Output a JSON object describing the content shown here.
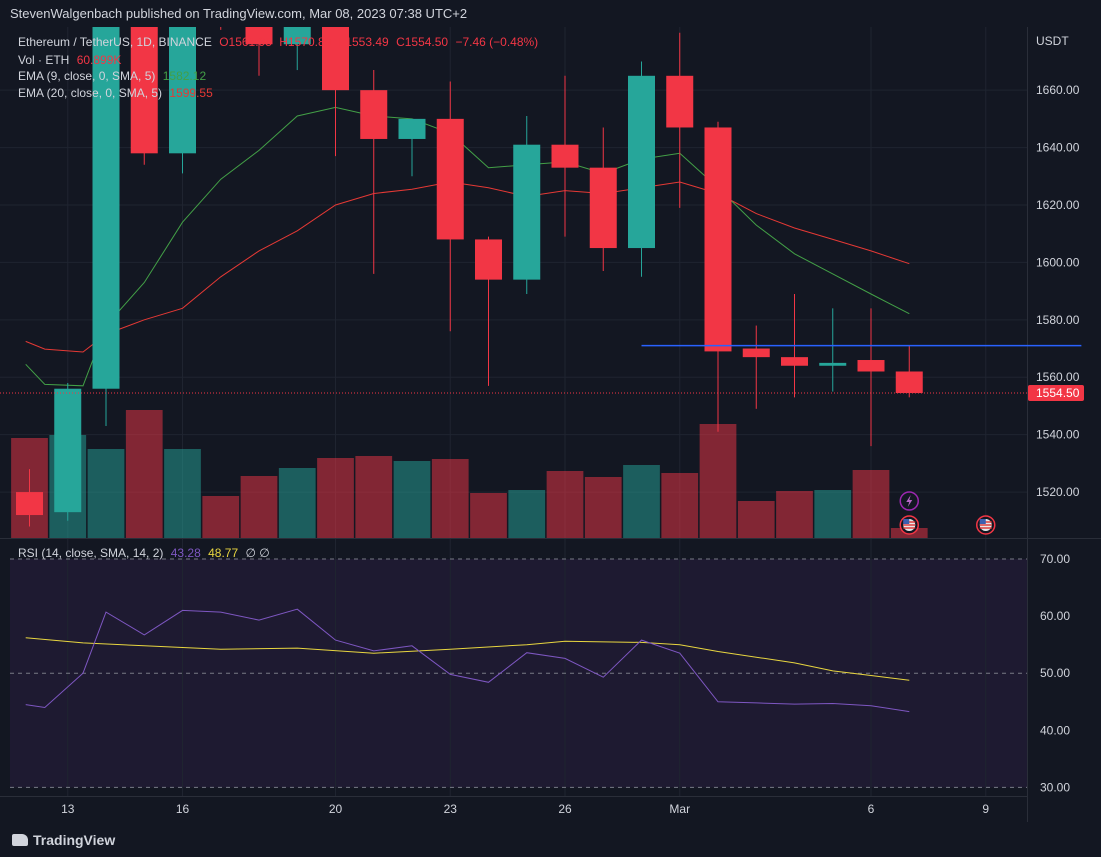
{
  "header": {
    "publish_text": "StevenWalgenbach published on TradingView.com, Mar 08, 2023 07:38 UTC+2"
  },
  "legend": {
    "symbol": "Ethereum / TetherUS, 1D, BINANCE",
    "open": "O1561.95",
    "high": "H1570.89",
    "low": "L1553.49",
    "close": "C1554.50",
    "change": "−7.46 (−0.48%)",
    "vol_label": "Vol · ETH",
    "vol_value": "60.899K",
    "ema9_label": "EMA (9, close, 0, SMA, 5)",
    "ema9_value": "1582.12",
    "ema20_label": "EMA (20, close, 0, SMA, 5)",
    "ema20_value": "1599.55",
    "rsi_label": "RSI (14, close, SMA, 14, 2)",
    "rsi_value": "43.28",
    "rsi_sma_value": "48.77",
    "rsi_extra": "∅ ∅"
  },
  "price_axis": {
    "unit": "USDT",
    "last_price": "1554.50"
  },
  "footer": {
    "brand": "TradingView"
  },
  "colors": {
    "up": "#26a69a",
    "down": "#f23645",
    "ema9": "#43a047",
    "ema20": "#e53935",
    "rsi": "#7e57c2",
    "rsi_sma": "#e8d640",
    "hline": "#2962ff"
  },
  "chart_data": [
    {
      "type": "candlestick",
      "title": "Ethereum / TetherUS, 1D, BINANCE",
      "x_ticks": [
        {
          "day": 1,
          "label": "13"
        },
        {
          "day": 4,
          "label": "16"
        },
        {
          "day": 8,
          "label": "20"
        },
        {
          "day": 11,
          "label": "23"
        },
        {
          "day": 14,
          "label": "26"
        },
        {
          "day": 17,
          "label": "Mar"
        },
        {
          "day": 22,
          "label": "6"
        },
        {
          "day": 25,
          "label": "9"
        }
      ],
      "y_ticks": [
        1520,
        1540,
        1560,
        1580,
        1600,
        1620,
        1640,
        1660
      ],
      "ylim": [
        1504,
        1682
      ],
      "candles": [
        {
          "day": 0,
          "open": 1520,
          "high": 1528,
          "low": 1508,
          "close": 1512
        },
        {
          "day": 1,
          "open": 1513,
          "high": 1558,
          "low": 1510,
          "close": 1556
        },
        {
          "day": 2,
          "open": 1556,
          "high": 1703,
          "low": 1543,
          "close": 1697
        },
        {
          "day": 3,
          "open": 1697,
          "high": 1701,
          "low": 1634,
          "close": 1638
        },
        {
          "day": 4,
          "open": 1638,
          "high": 1708,
          "low": 1631,
          "close": 1701
        },
        {
          "day": 5,
          "open": 1701,
          "high": 1712,
          "low": 1681,
          "close": 1695
        },
        {
          "day": 6,
          "open": 1695,
          "high": 1709,
          "low": 1665,
          "close": 1676
        },
        {
          "day": 7,
          "open": 1676,
          "high": 1705,
          "low": 1667,
          "close": 1701
        },
        {
          "day": 8,
          "open": 1701,
          "high": 1704,
          "low": 1637,
          "close": 1660
        },
        {
          "day": 9,
          "open": 1660,
          "high": 1667,
          "low": 1596,
          "close": 1643
        },
        {
          "day": 10,
          "open": 1643,
          "high": 1650,
          "low": 1630,
          "close": 1650
        },
        {
          "day": 11,
          "open": 1650,
          "high": 1663,
          "low": 1576,
          "close": 1608
        },
        {
          "day": 12,
          "open": 1608,
          "high": 1609,
          "low": 1557,
          "close": 1594
        },
        {
          "day": 13,
          "open": 1594,
          "high": 1651,
          "low": 1589,
          "close": 1641
        },
        {
          "day": 14,
          "open": 1641,
          "high": 1665,
          "low": 1609,
          "close": 1633
        },
        {
          "day": 15,
          "open": 1633,
          "high": 1647,
          "low": 1597,
          "close": 1605
        },
        {
          "day": 16,
          "open": 1605,
          "high": 1670,
          "low": 1595,
          "close": 1665
        },
        {
          "day": 17,
          "open": 1665,
          "high": 1680,
          "low": 1619,
          "close": 1647
        },
        {
          "day": 18,
          "open": 1647,
          "high": 1649,
          "low": 1541,
          "close": 1569
        },
        {
          "day": 19,
          "open": 1570,
          "high": 1578,
          "low": 1549,
          "close": 1567
        },
        {
          "day": 20,
          "open": 1567,
          "high": 1589,
          "low": 1553,
          "close": 1564
        },
        {
          "day": 21,
          "open": 1564,
          "high": 1584,
          "low": 1555,
          "close": 1565
        },
        {
          "day": 22,
          "open": 1566,
          "high": 1584,
          "low": 1536,
          "close": 1562
        },
        {
          "day": 23,
          "open": 1562,
          "high": 1571,
          "low": 1553,
          "close": 1554.5
        }
      ],
      "volume": [
        {
          "day": 0,
          "value": 100,
          "up": false
        },
        {
          "day": 1,
          "value": 103,
          "up": true
        },
        {
          "day": 2,
          "value": 89,
          "up": true
        },
        {
          "day": 3,
          "value": 128,
          "up": false
        },
        {
          "day": 4,
          "value": 89,
          "up": true
        },
        {
          "day": 5,
          "value": 42,
          "up": false
        },
        {
          "day": 6,
          "value": 62,
          "up": false
        },
        {
          "day": 7,
          "value": 70,
          "up": true
        },
        {
          "day": 8,
          "value": 80,
          "up": false
        },
        {
          "day": 9,
          "value": 82,
          "up": false
        },
        {
          "day": 10,
          "value": 77,
          "up": true
        },
        {
          "day": 11,
          "value": 79,
          "up": false
        },
        {
          "day": 12,
          "value": 45,
          "up": false
        },
        {
          "day": 13,
          "value": 48,
          "up": true
        },
        {
          "day": 14,
          "value": 67,
          "up": false
        },
        {
          "day": 15,
          "value": 61,
          "up": false
        },
        {
          "day": 16,
          "value": 73,
          "up": true
        },
        {
          "day": 17,
          "value": 65,
          "up": false
        },
        {
          "day": 18,
          "value": 114,
          "up": false
        },
        {
          "day": 19,
          "value": 37,
          "up": false
        },
        {
          "day": 20,
          "value": 47,
          "up": false
        },
        {
          "day": 21,
          "value": 48,
          "up": true
        },
        {
          "day": 22,
          "value": 68,
          "up": false
        },
        {
          "day": 23,
          "value": 10,
          "up": false
        }
      ],
      "ema9": [
        {
          "day": -0.1,
          "value": 1564.5
        },
        {
          "day": 0.4,
          "value": 1557.5
        },
        {
          "day": 1.4,
          "value": 1557
        },
        {
          "day": 2,
          "value": 1578
        },
        {
          "day": 3,
          "value": 1593
        },
        {
          "day": 4,
          "value": 1614
        },
        {
          "day": 5,
          "value": 1629
        },
        {
          "day": 6,
          "value": 1639
        },
        {
          "day": 7,
          "value": 1651
        },
        {
          "day": 8,
          "value": 1654
        },
        {
          "day": 9,
          "value": 1651
        },
        {
          "day": 10,
          "value": 1650
        },
        {
          "day": 11,
          "value": 1645
        },
        {
          "day": 12,
          "value": 1633
        },
        {
          "day": 13,
          "value": 1634
        },
        {
          "day": 14,
          "value": 1635
        },
        {
          "day": 15,
          "value": 1631
        },
        {
          "day": 16,
          "value": 1636
        },
        {
          "day": 17,
          "value": 1638
        },
        {
          "day": 18,
          "value": 1626
        },
        {
          "day": 19,
          "value": 1613
        },
        {
          "day": 20,
          "value": 1603
        },
        {
          "day": 21,
          "value": 1596
        },
        {
          "day": 22,
          "value": 1589
        },
        {
          "day": 23,
          "value": 1582.12
        }
      ],
      "ema20": [
        {
          "day": -0.1,
          "value": 1572.5
        },
        {
          "day": 0.4,
          "value": 1569.8
        },
        {
          "day": 1.4,
          "value": 1568.8
        },
        {
          "day": 2,
          "value": 1575
        },
        {
          "day": 3,
          "value": 1580
        },
        {
          "day": 4,
          "value": 1584
        },
        {
          "day": 5,
          "value": 1595
        },
        {
          "day": 6,
          "value": 1604
        },
        {
          "day": 7,
          "value": 1611
        },
        {
          "day": 8,
          "value": 1620
        },
        {
          "day": 9,
          "value": 1624
        },
        {
          "day": 10,
          "value": 1625.5
        },
        {
          "day": 11,
          "value": 1628
        },
        {
          "day": 12,
          "value": 1626
        },
        {
          "day": 13,
          "value": 1623
        },
        {
          "day": 14,
          "value": 1625
        },
        {
          "day": 15,
          "value": 1624
        },
        {
          "day": 16,
          "value": 1626
        },
        {
          "day": 17,
          "value": 1628
        },
        {
          "day": 18,
          "value": 1624
        },
        {
          "day": 19,
          "value": 1617
        },
        {
          "day": 20,
          "value": 1612
        },
        {
          "day": 21,
          "value": 1608
        },
        {
          "day": 22,
          "value": 1604
        },
        {
          "day": 23,
          "value": 1599.55
        }
      ],
      "horizontal_line": {
        "value": 1571,
        "from_day": 16,
        "to_day": 27.5
      }
    },
    {
      "type": "line",
      "title": "RSI (14, close, SMA, 14, 2)",
      "y_ticks": [
        30,
        40,
        50,
        60,
        70
      ],
      "ylim": [
        28.5,
        73.5
      ],
      "band": [
        30,
        70
      ],
      "series": [
        {
          "name": "RSI",
          "points": [
            {
              "day": -0.1,
              "value": 44.5
            },
            {
              "day": 0.4,
              "value": 44
            },
            {
              "day": 1.4,
              "value": 50
            },
            {
              "day": 2,
              "value": 60.7
            },
            {
              "day": 3,
              "value": 56.7
            },
            {
              "day": 4,
              "value": 61
            },
            {
              "day": 5,
              "value": 60.7
            },
            {
              "day": 6,
              "value": 59.3
            },
            {
              "day": 7,
              "value": 61.2
            },
            {
              "day": 8,
              "value": 55.8
            },
            {
              "day": 9,
              "value": 53.9
            },
            {
              "day": 10,
              "value": 54.8
            },
            {
              "day": 11,
              "value": 49.8
            },
            {
              "day": 12,
              "value": 48.4
            },
            {
              "day": 13,
              "value": 53.6
            },
            {
              "day": 14,
              "value": 52.6
            },
            {
              "day": 15,
              "value": 49.3
            },
            {
              "day": 16,
              "value": 55.8
            },
            {
              "day": 17,
              "value": 53.5
            },
            {
              "day": 18,
              "value": 45
            },
            {
              "day": 19,
              "value": 44.8
            },
            {
              "day": 20,
              "value": 44.6
            },
            {
              "day": 21,
              "value": 44.7
            },
            {
              "day": 22,
              "value": 44.3
            },
            {
              "day": 23,
              "value": 43.28
            }
          ]
        },
        {
          "name": "RSI SMA",
          "points": [
            {
              "day": -0.1,
              "value": 56.2
            },
            {
              "day": 1.4,
              "value": 55.3
            },
            {
              "day": 3,
              "value": 54.8
            },
            {
              "day": 5,
              "value": 54.2
            },
            {
              "day": 7,
              "value": 54.4
            },
            {
              "day": 9,
              "value": 53.5
            },
            {
              "day": 11,
              "value": 54.2
            },
            {
              "day": 13,
              "value": 55
            },
            {
              "day": 14,
              "value": 55.6
            },
            {
              "day": 16,
              "value": 55.4
            },
            {
              "day": 17,
              "value": 55
            },
            {
              "day": 18,
              "value": 53.8
            },
            {
              "day": 20,
              "value": 51.8
            },
            {
              "day": 21,
              "value": 50.4
            },
            {
              "day": 22,
              "value": 49.6
            },
            {
              "day": 23,
              "value": 48.77
            }
          ]
        }
      ]
    }
  ]
}
